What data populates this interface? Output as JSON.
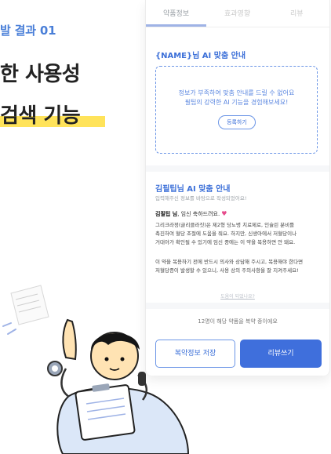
{
  "slide": {
    "label": "발 결과 01",
    "heading_line1": "한 사용성",
    "heading_line2": "검색 기능"
  },
  "phone": {
    "tabs": [
      "약품정보",
      "효과영향",
      "리뷰"
    ],
    "ai_guide": {
      "title": "{NAME}님 AI 맞춤 안내",
      "message_line1": "정보가 부족하여 맞춤 안내를 드릴 수 없어요",
      "message_line2": "필팁의 강력한 AI 기능을 경험해보세요!",
      "register_label": "등록하기"
    },
    "kim_guide": {
      "title": "김필팁님 AI 맞춤 안내",
      "subtitle": "입력해주신 정보를 바탕으로 작성되었어요!",
      "greet_name": "김필팁 님",
      "greet_rest": ", 임신 축하드려요.",
      "line1": "그리크라정(글리클라짓)은 제2형 당뇨병 치료제로, 인슐린 분비를",
      "line2": "촉진하여 혈당 조절에 도움을 줘요. 하지만, 신생아에서 저혈당이나",
      "line3": "거대아가 확인될 수 있기에 임신 중에는 이 약을 복용하면 안 돼요.",
      "line4": "이 약을 복용하기 전에 반드시 의사와 상담해 주시고, 복용해야 한다면",
      "line5": "저혈당증이 발생할 수 있으니, 사용 상의 주의사항을 잘 지켜주세요!",
      "help_link": "도움이 되었나요?"
    },
    "count_text": "12명이 해당 약품을 복약 중이에요",
    "buttons": {
      "save": "복약정보 저장",
      "review": "리뷰쓰기"
    }
  },
  "colors": {
    "accent_blue": "#3f6fdc",
    "label_blue": "#4a7fd8",
    "highlight_yellow": "#ffe35a"
  }
}
